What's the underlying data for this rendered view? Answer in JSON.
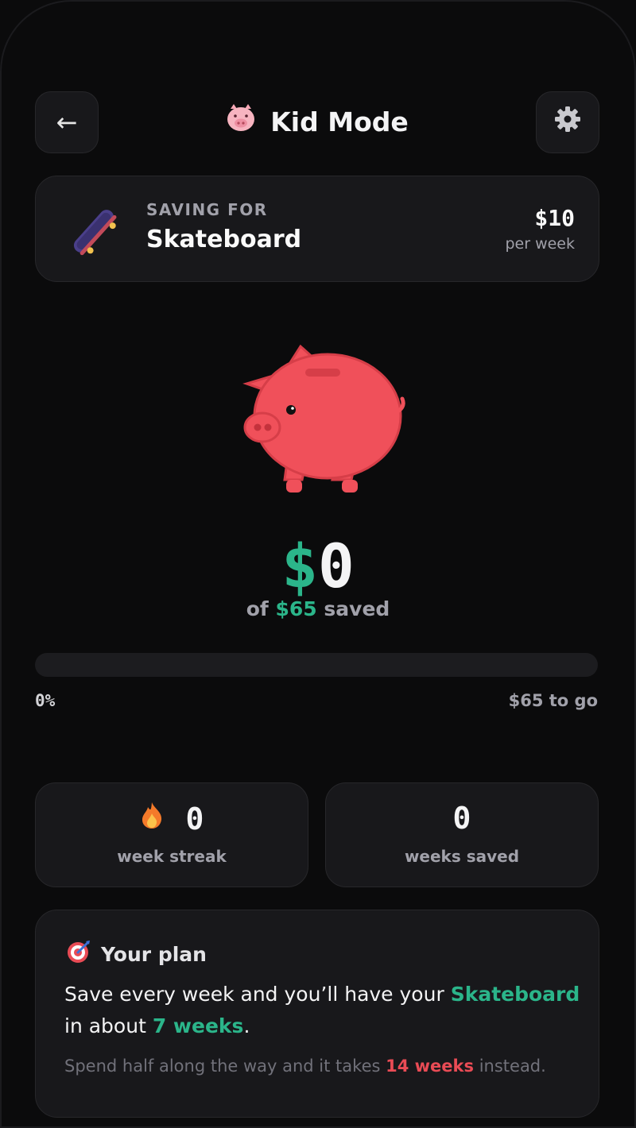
{
  "header": {
    "title": "Kid Mode",
    "back_icon": "left-arrow-icon",
    "settings_icon": "gear-icon",
    "mode_icon": "pig-face-icon"
  },
  "goal": {
    "kicker": "SAVING FOR",
    "name": "Skateboard",
    "amount": "$10",
    "per": "per week",
    "icon": "skateboard-icon"
  },
  "savings": {
    "currency": "$",
    "amount": "0",
    "of_prefix": "of",
    "target": "$65",
    "of_suffix": "saved",
    "progress_percent": 0,
    "progress_label": "0%",
    "to_go": "$65 to go"
  },
  "stats": {
    "streak_value": "0",
    "streak_label": "week streak",
    "weeks_value": "0",
    "weeks_label": "weeks saved"
  },
  "plan": {
    "title": "Your plan",
    "line_a": "Save every week and you’ll have your",
    "goal": "Skateboard",
    "line_b": "in about",
    "weeks": "7 weeks",
    "period": ".",
    "note_a": "Spend half along the way and it takes",
    "note_weeks": "14 weeks",
    "note_b": "instead."
  },
  "colors": {
    "accent": "#2bb58a",
    "pig": "#f0505a",
    "warning": "#e94b55",
    "background": "#0b0b0c",
    "card": "#18181b"
  }
}
